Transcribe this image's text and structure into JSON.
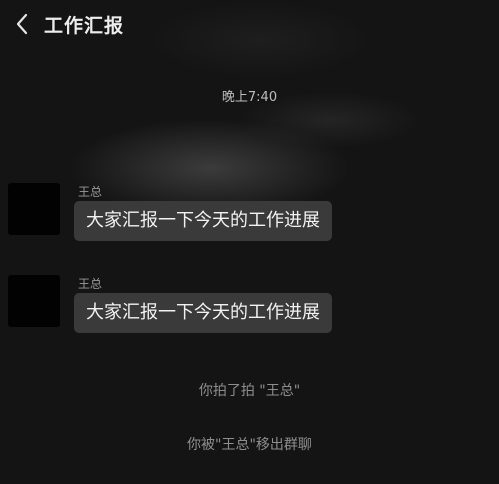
{
  "header": {
    "back_icon": "chevron-left-icon",
    "title": "工作汇报"
  },
  "timestamp": "晚上7:40",
  "messages": [
    {
      "sender": "王总",
      "text": "大家汇报一下今天的工作进展"
    },
    {
      "sender": "王总",
      "text": "大家汇报一下今天的工作进展"
    }
  ],
  "system_notices": [
    "你拍了拍 \"王总\"",
    "你被\"王总\"移出群聊"
  ]
}
